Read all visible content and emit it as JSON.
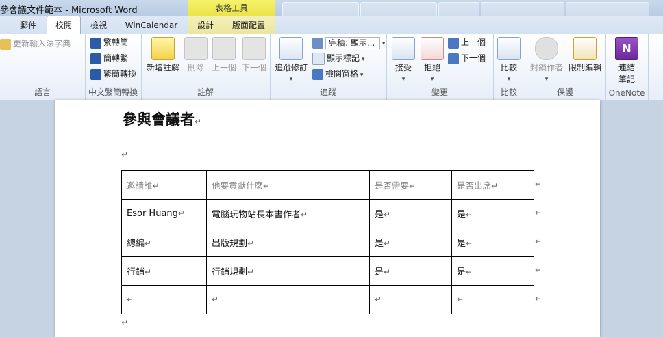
{
  "window": {
    "title": "參會議文件範本 - Microsoft Word",
    "contextual_group": "表格工具"
  },
  "tabs": [
    {
      "label": "郵件"
    },
    {
      "label": "校閱",
      "active": true
    },
    {
      "label": "檢視"
    },
    {
      "label": "WinCalendar"
    },
    {
      "label": "設計"
    },
    {
      "label": "版面配置"
    }
  ],
  "ribbon": {
    "language": {
      "label": "語言",
      "update_ime": "更新輸入法字典"
    },
    "chinese_conv": {
      "label": "中文繁簡轉換",
      "to_trad": "繁轉簡",
      "to_simp": "簡轉繁",
      "convert": "繁簡轉換"
    },
    "comments": {
      "label": "註解",
      "new": "新增註解",
      "delete": "刪除",
      "prev": "上一個",
      "next": "下一個"
    },
    "tracking": {
      "label": "追蹤",
      "track": "追蹤修訂",
      "markup_select": "完稿: 顯示...",
      "show_markup": "顯示標記",
      "review_pane": "檢閱窗格"
    },
    "changes": {
      "label": "變更",
      "accept": "接受",
      "reject": "拒絕",
      "prev": "上一個",
      "next": "下一個"
    },
    "compare": {
      "label": "比較",
      "compare": "比較"
    },
    "protect": {
      "label": "保護",
      "block_authors": "封鎖作者",
      "restrict": "限制編輯"
    },
    "onenote": {
      "label": "OneNote",
      "linked_notes": "連結",
      "linked_notes2": "筆記"
    }
  },
  "document": {
    "heading": "參與會議者",
    "table": {
      "headers": [
        "邀請誰",
        "他要貢獻什麼",
        "是否需要",
        "是否出席"
      ],
      "rows": [
        [
          "Esor Huang",
          "電腦玩物站長本書作者",
          "是",
          "是"
        ],
        [
          "總編",
          "出版規劃",
          "是",
          "是"
        ],
        [
          "行銷",
          "行銷規劃",
          "是",
          "是"
        ],
        [
          "",
          "",
          "",
          ""
        ]
      ]
    }
  },
  "colors": {
    "ribbon_bg": "#e7eef8",
    "contextual_yellow": "#e9e24a"
  }
}
